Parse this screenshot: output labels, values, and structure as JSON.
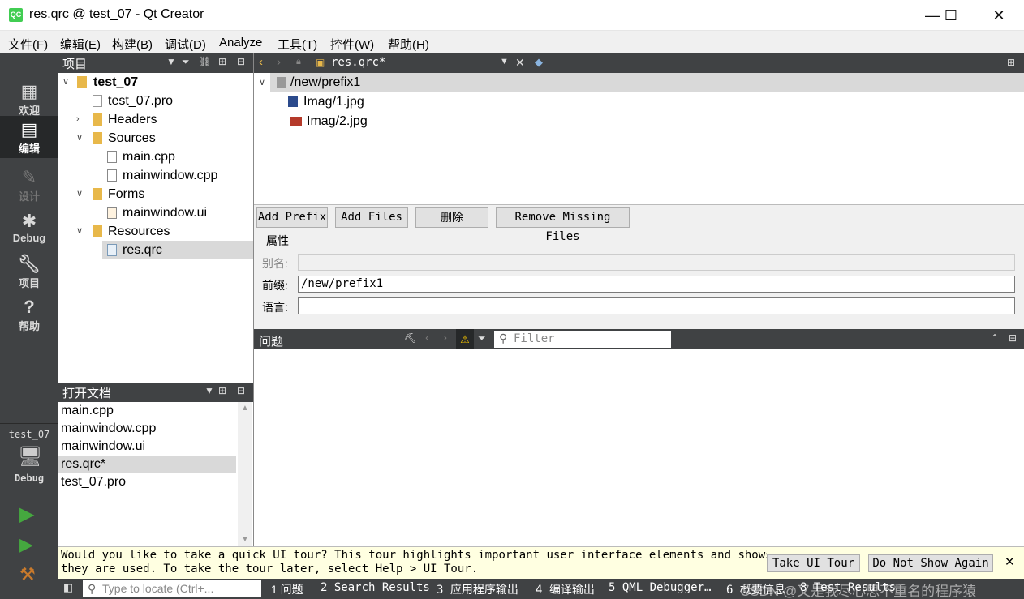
{
  "window": {
    "app_icon": "QC",
    "title": "res.qrc @ test_07 - Qt Creator",
    "minimize": "—",
    "maximize": "☐",
    "close": "✕"
  },
  "menu": [
    "文件(F)",
    "编辑(E)",
    "构建(B)",
    "调试(D)",
    "Analyze",
    "工具(T)",
    "控件(W)",
    "帮助(H)"
  ],
  "modes": {
    "welcome": "欢迎",
    "edit": "编辑",
    "design": "设计",
    "debug": "Debug",
    "projects": "项目",
    "help": "帮助",
    "target_project": "test_07",
    "target_config": "Debug"
  },
  "project_panel": {
    "title": "项目",
    "tree": [
      {
        "label": "test_07",
        "bold": true,
        "icon": "project-icon"
      },
      {
        "label": "test_07.pro",
        "icon": "pro-file-icon"
      },
      {
        "label": "Headers",
        "icon": "headers-folder-icon"
      },
      {
        "label": "Sources",
        "icon": "sources-folder-icon"
      },
      {
        "label": "main.cpp",
        "icon": "cpp-file-icon"
      },
      {
        "label": "mainwindow.cpp",
        "icon": "cpp-file-icon"
      },
      {
        "label": "Forms",
        "icon": "forms-folder-icon"
      },
      {
        "label": "mainwindow.ui",
        "icon": "ui-file-icon"
      },
      {
        "label": "Resources",
        "icon": "resources-folder-icon"
      },
      {
        "label": "res.qrc",
        "icon": "qrc-file-icon"
      }
    ]
  },
  "open_docs": {
    "title": "打开文档",
    "items": [
      "main.cpp",
      "mainwindow.cpp",
      "mainwindow.ui",
      "res.qrc*",
      "test_07.pro"
    ]
  },
  "editor": {
    "current_file": "res.qrc*",
    "prefix": "/new/prefix1",
    "files": [
      "Imag/1.jpg",
      "Imag/2.jpg"
    ],
    "buttons": {
      "add_prefix": "Add Prefix",
      "add_files": "Add Files",
      "delete": "删除",
      "remove_missing": "Remove Missing Files"
    },
    "properties": {
      "group_title": "属性",
      "alias_label": "别名:",
      "alias_value": "",
      "prefix_label": "前缀:",
      "prefix_value": "/new/prefix1",
      "lang_label": "语言:",
      "lang_value": ""
    }
  },
  "issues": {
    "title": "问题",
    "filter_placeholder": "Filter"
  },
  "tour": {
    "message_line1": "Would you like to take a quick UI tour? This tour highlights important user interface elements and shows how",
    "message_line2": "they are used. To take the tour later, select Help > UI Tour.",
    "take_tour": "Take UI Tour",
    "dont_show": "Do Not Show Again",
    "close": "✕"
  },
  "statusbar": {
    "locator_placeholder": "Type to locate (Ctrl+...",
    "tabs": [
      "1 问题",
      "2 Search Results",
      "3 应用程序输出",
      "4 编译输出",
      "5 QML Debugger…",
      "6 概要信息",
      "8 Test Results"
    ]
  },
  "watermark": "CSDN @又是我尽心思不重名的程序猿",
  "colors": {
    "dark_panel": "#404244",
    "active_mode": "#262829",
    "selection": "#d9d9d9",
    "tour_bg": "#ffffe1",
    "run_green": "#45a83f"
  }
}
